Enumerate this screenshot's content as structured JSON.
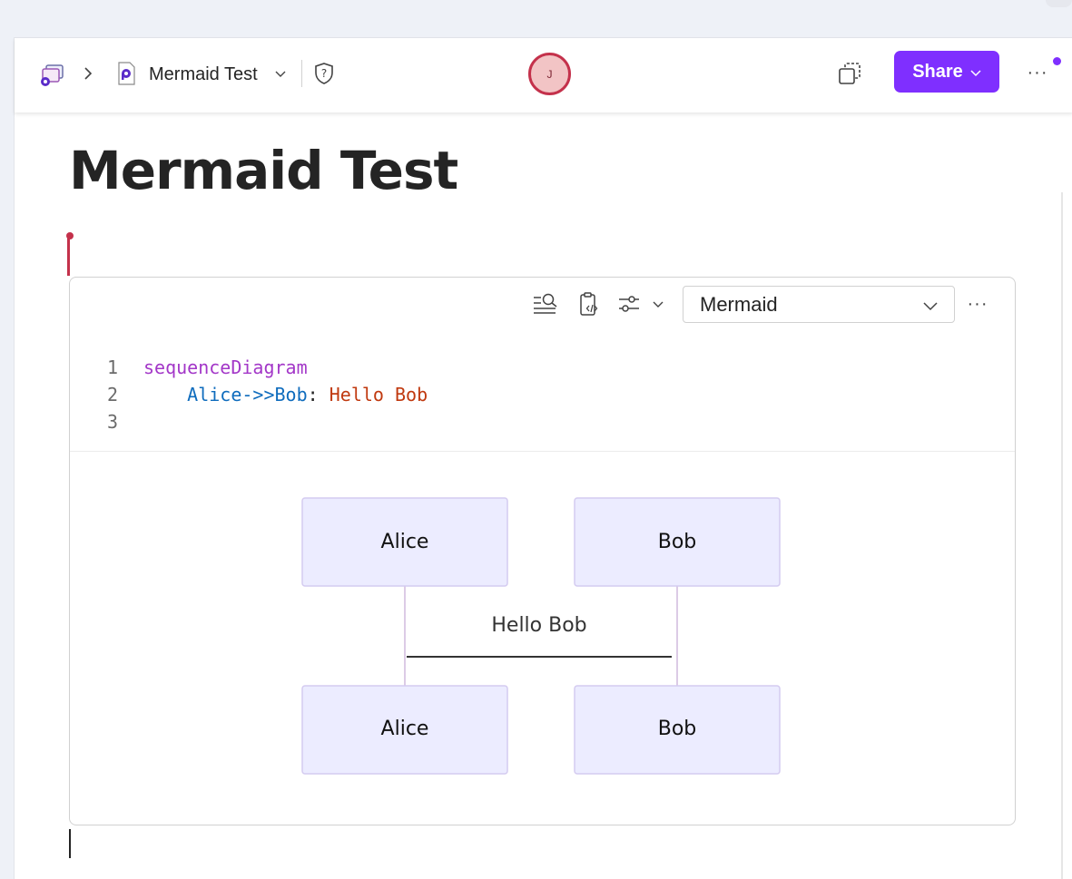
{
  "header": {
    "doc_title": "Mermaid Test",
    "avatar_initial": "J",
    "share_label": "Share",
    "more_label": "···"
  },
  "page": {
    "title": "Mermaid Test"
  },
  "code_block": {
    "language": "Mermaid",
    "more_label": "···",
    "lines": [
      {
        "number": "1",
        "keyword": "sequenceDiagram"
      },
      {
        "number": "2",
        "indent": "    ",
        "from": "Alice",
        "arrow": "->>",
        "to": "Bob",
        "colon": ": ",
        "message": "Hello Bob"
      },
      {
        "number": "3"
      }
    ]
  },
  "diagram": {
    "participants_top": [
      "Alice",
      "Bob"
    ],
    "participants_bottom": [
      "Alice",
      "Bob"
    ],
    "message": "Hello Bob",
    "colors": {
      "actor_fill": "#ececff",
      "actor_stroke": "#d4cbf0",
      "lifeline": "#dccbe6",
      "message_line": "#333333"
    }
  },
  "colors": {
    "accent": "#7f2fff",
    "presence": "#c4314b"
  }
}
